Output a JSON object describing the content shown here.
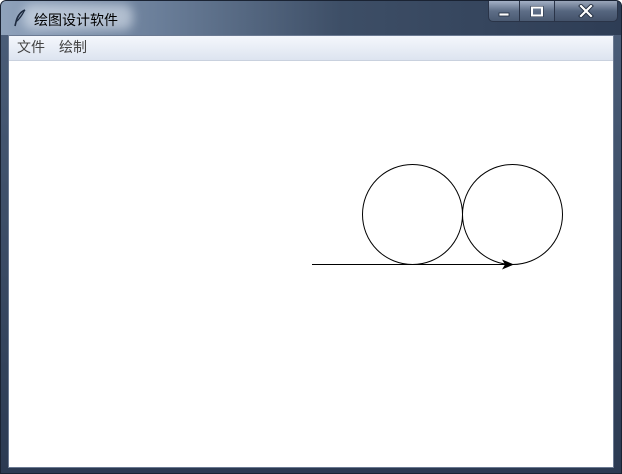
{
  "window": {
    "title": "绘图设计软件",
    "app_icon": "feather-icon",
    "controls": [
      "minimize-icon",
      "maximize-icon",
      "close-icon"
    ]
  },
  "menu": {
    "items": [
      {
        "label": "文件"
      },
      {
        "label": "绘制"
      }
    ]
  },
  "canvas": {
    "background": "#ffffff",
    "stroke_color": "#000000",
    "shapes": [
      "circle",
      "circle",
      "arrow-line"
    ]
  }
}
